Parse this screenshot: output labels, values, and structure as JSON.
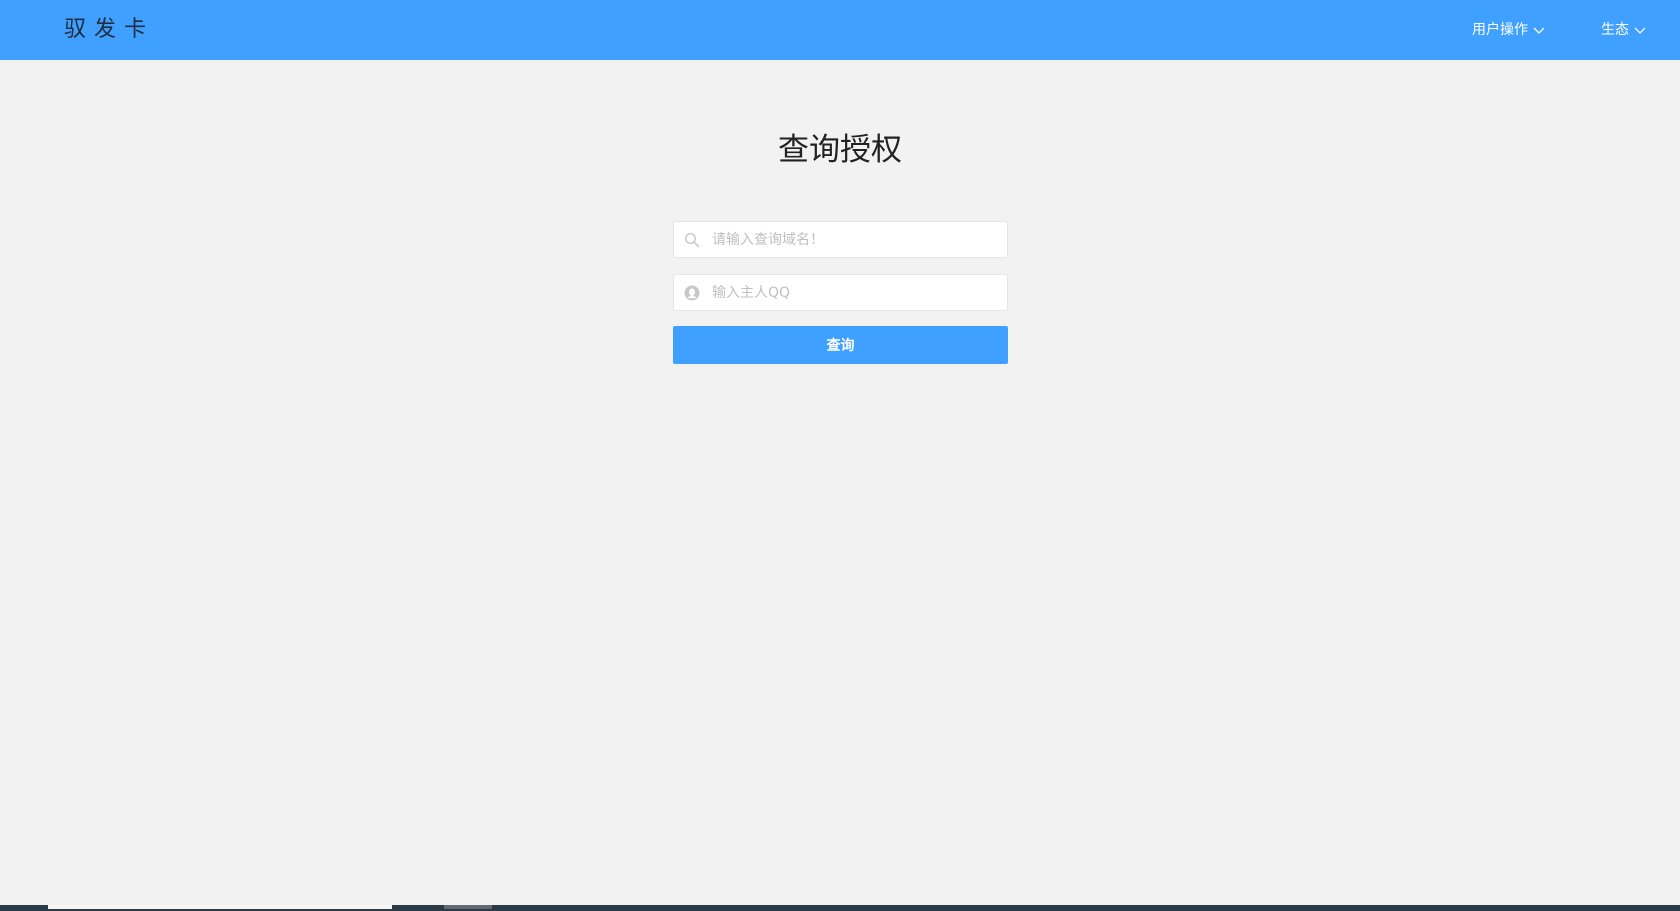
{
  "header": {
    "logo": "驭发卡",
    "nav": [
      {
        "label": "用户操作"
      },
      {
        "label": "生态"
      }
    ],
    "colors": {
      "bar": "#40a0ff",
      "text": "#ffffff"
    }
  },
  "main": {
    "title": "查询授权",
    "domain_field": {
      "placeholder": "请输入查询域名！",
      "value": "",
      "icon": "search-icon"
    },
    "qq_field": {
      "placeholder": "输入主人QQ",
      "value": "",
      "icon": "qq-icon"
    },
    "submit_label": "查询"
  }
}
